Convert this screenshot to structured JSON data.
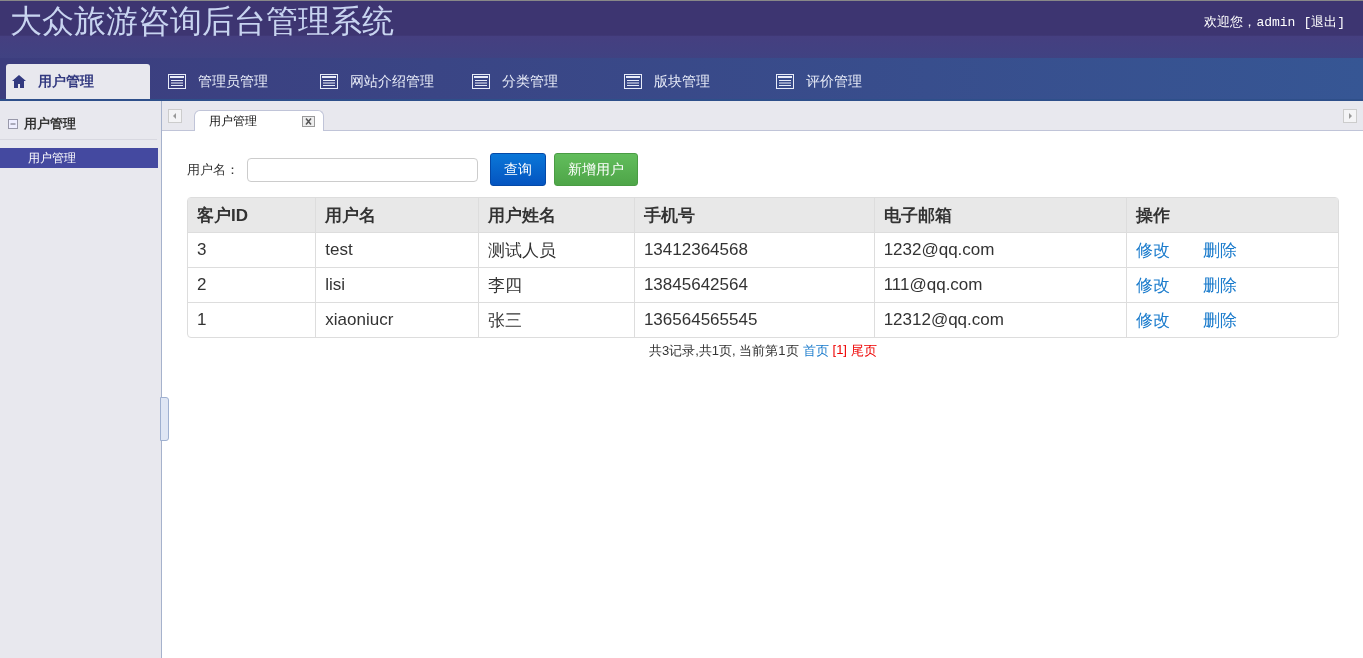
{
  "header": {
    "title": "大众旅游咨询后台管理系统",
    "welcome": "欢迎您，admin",
    "logout": "[退出]"
  },
  "nav": [
    {
      "label": "用户管理",
      "kind": "home",
      "selected": true
    },
    {
      "label": "管理员管理",
      "kind": "list",
      "selected": false
    },
    {
      "label": "网站介绍管理",
      "kind": "list",
      "selected": false
    },
    {
      "label": "分类管理",
      "kind": "list",
      "selected": false
    },
    {
      "label": "版块管理",
      "kind": "list",
      "selected": false
    },
    {
      "label": "评价管理",
      "kind": "list",
      "selected": false
    }
  ],
  "sidebar": {
    "title": "用户管理",
    "items": [
      {
        "label": "用户管理",
        "selected": true
      }
    ]
  },
  "tabs": [
    {
      "label": "用户管理",
      "selected": true
    }
  ],
  "search": {
    "label": "用户名：",
    "buttons": [
      {
        "label": "查询",
        "kind": "primary"
      },
      {
        "label": "新增用户",
        "kind": "success"
      }
    ]
  },
  "table": {
    "columns": [
      "客户ID",
      "用户名",
      "用户姓名",
      "手机号",
      "电子邮箱",
      "操作"
    ],
    "rows": [
      {
        "cells": [
          "3",
          "test",
          "测试人员",
          "13412364568",
          "1232@qq.com"
        ],
        "actions": [
          "修改",
          "删除"
        ]
      },
      {
        "cells": [
          "2",
          "lisi",
          "李四",
          "13845642564",
          "111@qq.com"
        ],
        "actions": [
          "修改",
          "删除"
        ]
      },
      {
        "cells": [
          "1",
          "xiaoniucr",
          "张三",
          "136564565545",
          "12312@qq.com"
        ],
        "actions": [
          "修改",
          "删除"
        ]
      }
    ]
  },
  "pagination": {
    "summary": "共3记录,共1页, 当前第1页",
    "links": [
      {
        "label": "首页",
        "kind": "link"
      },
      {
        "label": "[1]",
        "kind": "current"
      },
      {
        "label": "尾页",
        "kind": "current"
      }
    ]
  }
}
